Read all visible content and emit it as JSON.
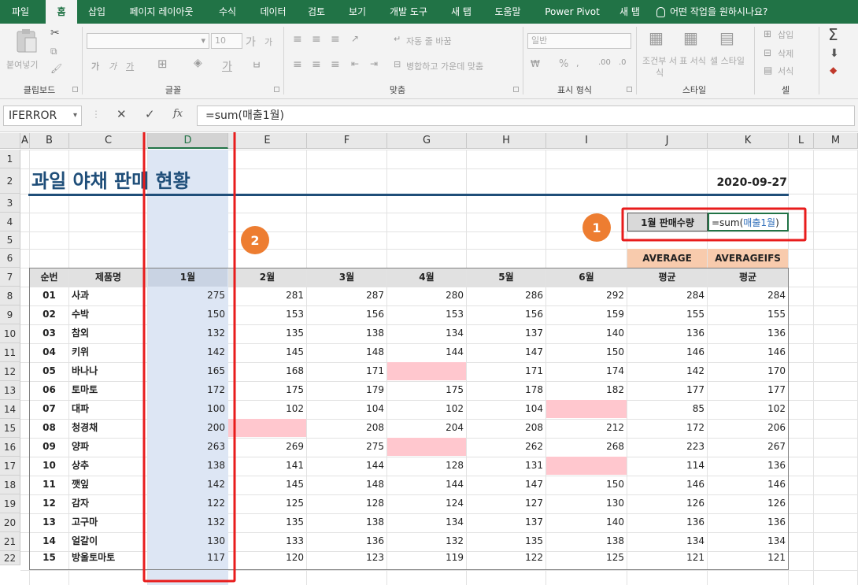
{
  "tabs": [
    "파일",
    "홈",
    "삽입",
    "페이지 레이아웃",
    "수식",
    "데이터",
    "검토",
    "보기",
    "개발 도구",
    "새 탭",
    "도움말",
    "Power Pivot",
    "새 탭",
    "어떤 작업을 원하시나요?"
  ],
  "ribbon": {
    "clipboard": {
      "paste": "붙여넣기",
      "label": "클립보드"
    },
    "font": {
      "size": "10",
      "label": "글꼴",
      "bold": "가",
      "italic": "가",
      "underline": "가",
      "grow": "가",
      "shrink": "가",
      "fontcolor": "가"
    },
    "alignment": {
      "wrap": "자동 줄 바꿈",
      "merge": "병합하고 가운데 맞춤",
      "label": "맞춤"
    },
    "number": {
      "format": "일반",
      "percent": "%",
      "label": "표시 형식"
    },
    "styles": {
      "conditional": "조건부 서식",
      "table": "표 서식",
      "cell": "셀 스타일",
      "label": "스타일"
    },
    "cells": {
      "insert": "삽입",
      "delete": "삭제",
      "format": "서식",
      "label": "셀"
    }
  },
  "formula_bar": {
    "name_box": "IFERROR",
    "formula": "=sum(매출1월)",
    "cancel": "✕",
    "enter": "✓",
    "fx": "fx"
  },
  "columns": [
    "A",
    "B",
    "C",
    "D",
    "E",
    "F",
    "G",
    "H",
    "I",
    "J",
    "K",
    "L",
    "M"
  ],
  "rows": [
    "1",
    "2",
    "3",
    "4",
    "5",
    "6",
    "7",
    "8",
    "9",
    "10",
    "11",
    "12",
    "13",
    "14",
    "15",
    "16",
    "17",
    "18",
    "19",
    "20",
    "21",
    "22"
  ],
  "sheet": {
    "title": "과일 야채 판매 현황",
    "date": "2020-09-27",
    "formula_label": "1월 판매수량",
    "formula_prefix": "=sum(",
    "formula_name": "매출1월",
    "formula_suffix": ")",
    "badge1": "1",
    "badge2": "2",
    "func_headers": [
      "AVERAGE",
      "AVERAGEIFS"
    ],
    "headers": [
      "순번",
      "제품명",
      "1월",
      "2월",
      "3월",
      "4월",
      "5월",
      "6월",
      "평균",
      "평균"
    ],
    "data": [
      [
        "01",
        "사과",
        "275",
        "281",
        "287",
        "280",
        "286",
        "292",
        "284",
        "284"
      ],
      [
        "02",
        "수박",
        "150",
        "153",
        "156",
        "153",
        "156",
        "159",
        "155",
        "155"
      ],
      [
        "03",
        "참외",
        "132",
        "135",
        "138",
        "134",
        "137",
        "140",
        "136",
        "136"
      ],
      [
        "04",
        "키위",
        "142",
        "145",
        "148",
        "144",
        "147",
        "150",
        "146",
        "146"
      ],
      [
        "05",
        "바나나",
        "165",
        "168",
        "171",
        "",
        "171",
        "174",
        "142",
        "170"
      ],
      [
        "06",
        "토마토",
        "172",
        "175",
        "179",
        "175",
        "178",
        "182",
        "177",
        "177"
      ],
      [
        "07",
        "대파",
        "100",
        "102",
        "104",
        "102",
        "104",
        "",
        "85",
        "102"
      ],
      [
        "08",
        "청경채",
        "200",
        "",
        "208",
        "204",
        "208",
        "212",
        "172",
        "206"
      ],
      [
        "09",
        "양파",
        "263",
        "269",
        "275",
        "",
        "262",
        "268",
        "223",
        "267"
      ],
      [
        "10",
        "상추",
        "138",
        "141",
        "144",
        "128",
        "131",
        "",
        "114",
        "136"
      ],
      [
        "11",
        "깻잎",
        "142",
        "145",
        "148",
        "144",
        "147",
        "150",
        "146",
        "146"
      ],
      [
        "12",
        "감자",
        "122",
        "125",
        "128",
        "124",
        "127",
        "130",
        "126",
        "126"
      ],
      [
        "13",
        "고구마",
        "132",
        "135",
        "138",
        "134",
        "137",
        "140",
        "136",
        "136"
      ],
      [
        "14",
        "얼갈이",
        "130",
        "133",
        "136",
        "132",
        "135",
        "138",
        "134",
        "134"
      ],
      [
        "15",
        "방울토마토",
        "117",
        "120",
        "123",
        "119",
        "122",
        "125",
        "121",
        "121"
      ]
    ]
  },
  "colors": {
    "accent": "#217346",
    "title": "#1f4e79",
    "badge": "#ed7d31",
    "highlight_red": "#e81c1c",
    "empty_fill": "#ffc7ce",
    "func_header_fill": "#f8cbad",
    "column_select": "#dde6f4"
  }
}
